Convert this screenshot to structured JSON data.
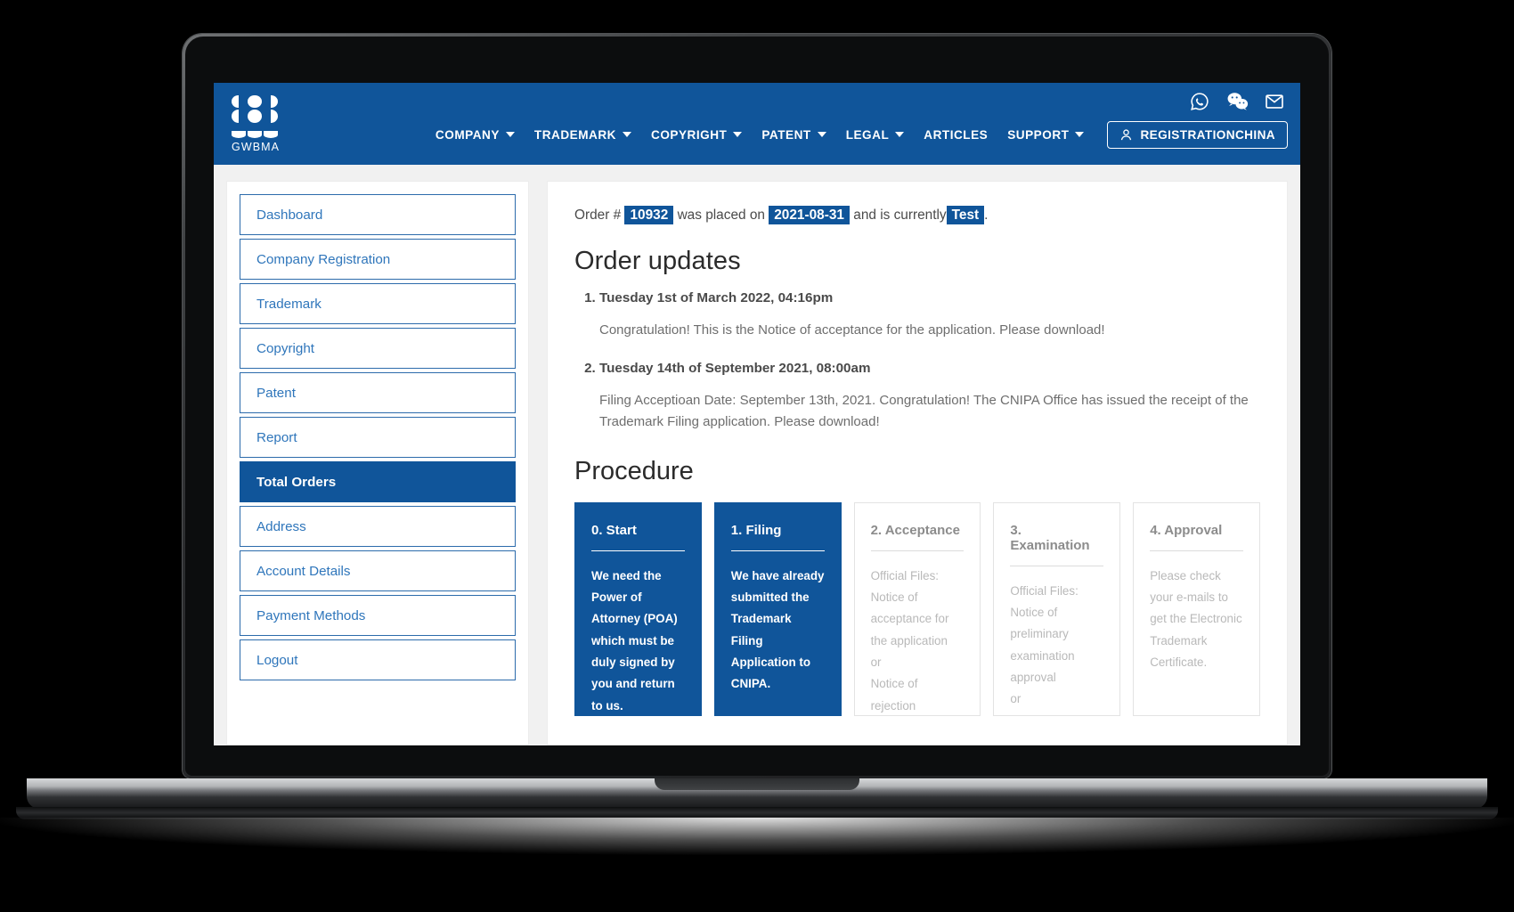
{
  "header": {
    "brand": {
      "name": "GWBMA",
      "logo_icon": "gwbma-petal-grid-logo"
    },
    "social": [
      {
        "name": "whatsapp-icon",
        "label": "WhatsApp"
      },
      {
        "name": "wechat-icon",
        "label": "WeChat"
      },
      {
        "name": "email-icon",
        "label": "Email"
      }
    ],
    "nav": [
      {
        "label": "COMPANY",
        "has_caret": true
      },
      {
        "label": "TRADEMARK",
        "has_caret": true
      },
      {
        "label": "COPYRIGHT",
        "has_caret": true
      },
      {
        "label": "PATENT",
        "has_caret": true
      },
      {
        "label": "LEGAL",
        "has_caret": true
      },
      {
        "label": "ARTICLES",
        "has_caret": false
      },
      {
        "label": "SUPPORT",
        "has_caret": true
      }
    ],
    "account_button": "REGISTRATIONCHINA",
    "background_color": "#10559a"
  },
  "sidebar": {
    "items": [
      {
        "label": "Dashboard",
        "active": false
      },
      {
        "label": "Company Registration",
        "active": false
      },
      {
        "label": "Trademark",
        "active": false
      },
      {
        "label": "Copyright",
        "active": false
      },
      {
        "label": "Patent",
        "active": false
      },
      {
        "label": "Report",
        "active": false
      },
      {
        "label": "Total Orders",
        "active": true
      },
      {
        "label": "Address",
        "active": false
      },
      {
        "label": "Account Details",
        "active": false
      },
      {
        "label": "Payment Methods",
        "active": false
      },
      {
        "label": "Logout",
        "active": false
      }
    ]
  },
  "content": {
    "order_line": {
      "prefix": "Order #",
      "order_number": "10932",
      "middle": "was placed on",
      "order_date": "2021-08-31",
      "suffix": "and is currently",
      "status": "Test",
      "period": "."
    },
    "updates_title": "Order updates",
    "updates": [
      {
        "date": "Tuesday 1st of March 2022, 04:16pm",
        "body": "Congratulation! This is the Notice of acceptance for the application. Please download!"
      },
      {
        "date": "Tuesday 14th of September 2021, 08:00am",
        "body": "Filing Acceptioan Date: September 13th, 2021. Congratulation! The CNIPA Office has issued the receipt of the Trademark Filing application. Please download!"
      }
    ],
    "procedure_title": "Procedure",
    "procedure": [
      {
        "step": "0. Start",
        "text": "We need the Power of Attorney (POA) which must be duly signed by you and return to us.",
        "done": true
      },
      {
        "step": "1. Filing",
        "text": "We have already submitted the Trademark Filing Application to CNIPA.",
        "done": true
      },
      {
        "step": "2. Acceptance",
        "text": "Official Files:\nNotice of acceptance for the application\nor\nNotice of rejection",
        "done": false
      },
      {
        "step": "3. Examination",
        "text": "Official Files:\nNotice of preliminary examination approval\nor",
        "done": false
      },
      {
        "step": "4. Approval",
        "text": "Please check your e-mails to get the Electronic Trademark Certificate.",
        "done": false
      }
    ]
  },
  "colors": {
    "brand_blue": "#10559a",
    "link_blue": "#2f76bb",
    "page_bg": "#f1f1f1"
  }
}
